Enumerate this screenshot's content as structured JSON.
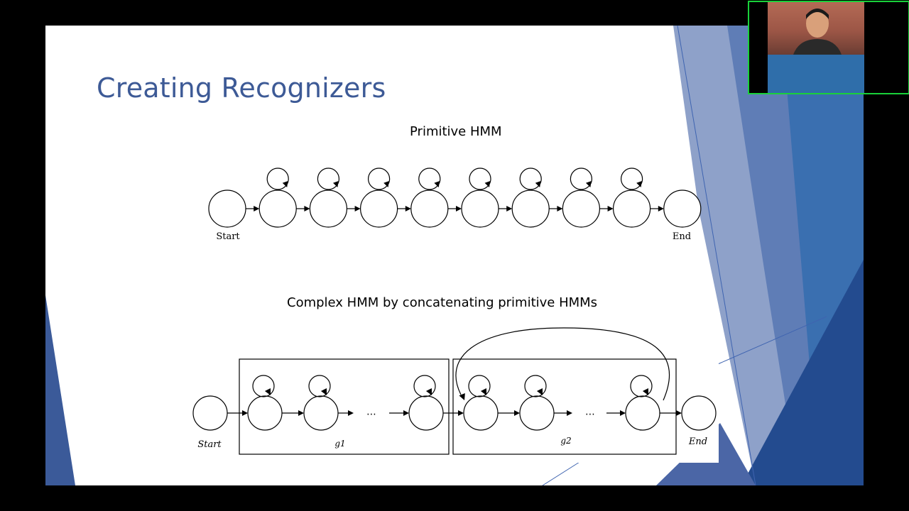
{
  "slide": {
    "title": "Creating Recognizers",
    "theme_colors": {
      "title": "#3d5a96",
      "deco_dark": "#2a4a8c",
      "deco_mid": "#4a6aa8",
      "deco_light": "#9fb0d4"
    }
  },
  "primitive_hmm": {
    "heading": "Primitive HMM",
    "start_label": "Start",
    "end_label": "End",
    "state_count": 8
  },
  "complex_hmm": {
    "heading": "Complex HMM by concatenating primitive HMMs",
    "start_label": "Start",
    "end_label": "End",
    "group_labels": [
      "g1",
      "g2"
    ],
    "ellipsis": "⋯"
  },
  "webcam": {
    "border_color": "#19d13a"
  }
}
